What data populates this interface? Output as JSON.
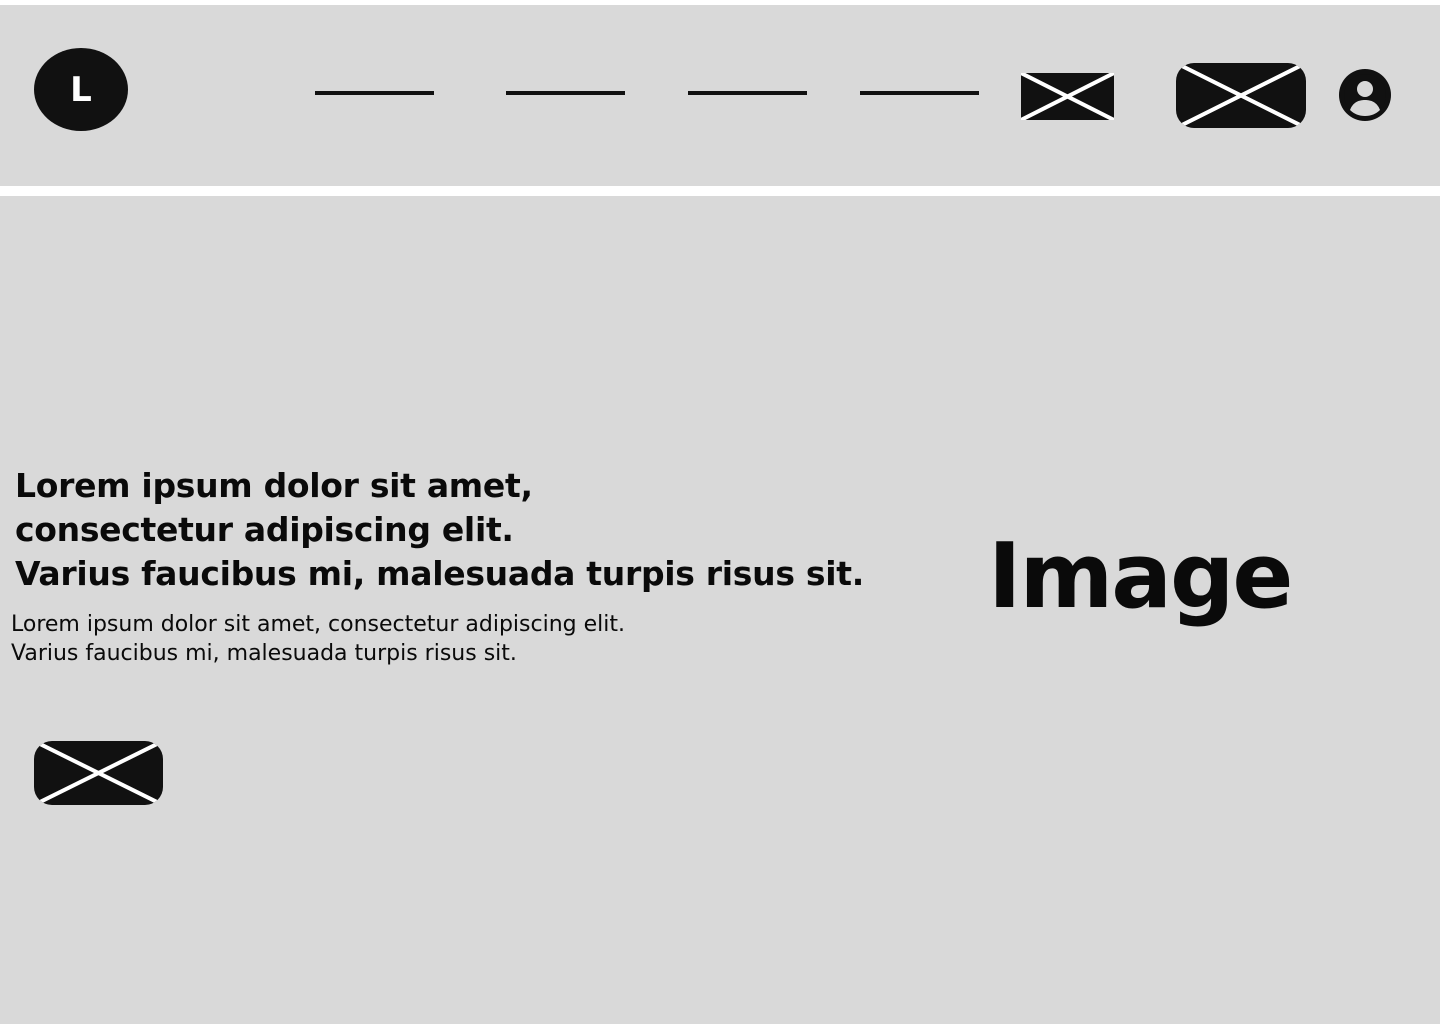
{
  "header": {
    "logo_letter": "L",
    "nav_items": [
      "",
      "",
      "",
      ""
    ],
    "icons": {
      "placeholder_small": "image-placeholder-icon",
      "placeholder_button": "button-placeholder-icon",
      "user": "user-account-icon"
    }
  },
  "hero": {
    "headline_lines": [
      "Lorem ipsum dolor sit amet,",
      "consectetur adipiscing elit.",
      "Varius faucibus mi, malesuada turpis risus sit."
    ],
    "body_lines": [
      "Lorem ipsum dolor sit amet, consectetur adipiscing elit.",
      "Varius faucibus mi, malesuada turpis risus sit."
    ],
    "image_label": "Image"
  },
  "colors": {
    "background": "#d9d9d9",
    "foreground": "#111111",
    "separator": "#ffffff"
  }
}
